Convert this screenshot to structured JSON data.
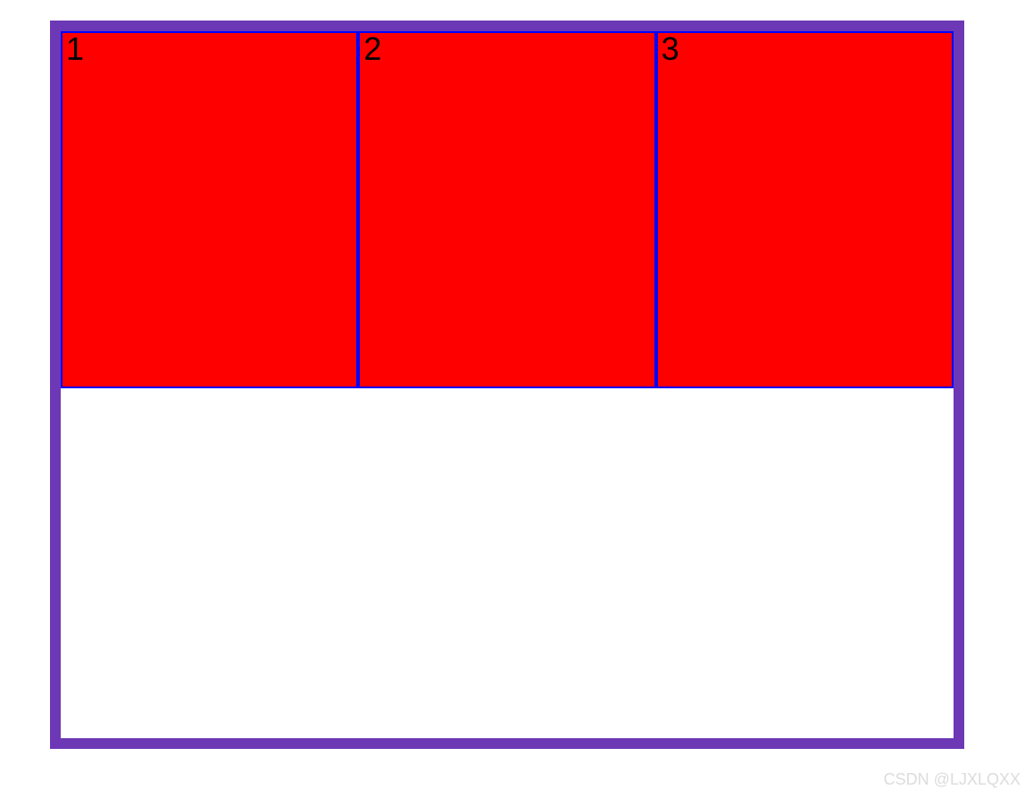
{
  "boxes": {
    "box1": "1",
    "box2": "2",
    "box3": "3"
  },
  "watermark": "CSDN @LJXLQXX",
  "colors": {
    "outer_border": "#6c38b6",
    "box_fill": "#ff0000",
    "box_border": "#0000ff"
  }
}
